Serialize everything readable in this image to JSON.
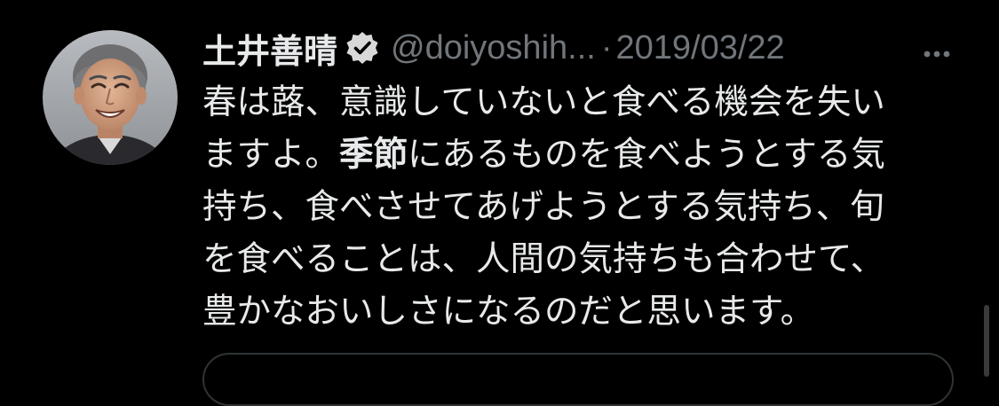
{
  "tweet": {
    "author": {
      "display_name": "土井善晴",
      "handle": "@doiyoshih...",
      "verified_icon": "verified-badge-icon",
      "avatar_icon": "avatar-photo"
    },
    "separator": "·",
    "date": "2019/03/22",
    "more_icon": "more-horizontal-icon",
    "text": {
      "line1": "春は蕗、意識していないと食べる機会を失い",
      "line2_before": "ますよ。",
      "line2_bold": "季節",
      "line2_after": "にあるものを食べようとする気",
      "line3": "持ち、食べさせてあげようとする気持ち、旬",
      "line4": "を食べることは、人間の気持ちも合わせて、",
      "line5": "豊かなおいしさになるのだと思います。"
    }
  },
  "colors": {
    "background": "#000000",
    "text": "#e7e9ea",
    "secondary_text": "#71767b",
    "border": "#2f3336"
  }
}
